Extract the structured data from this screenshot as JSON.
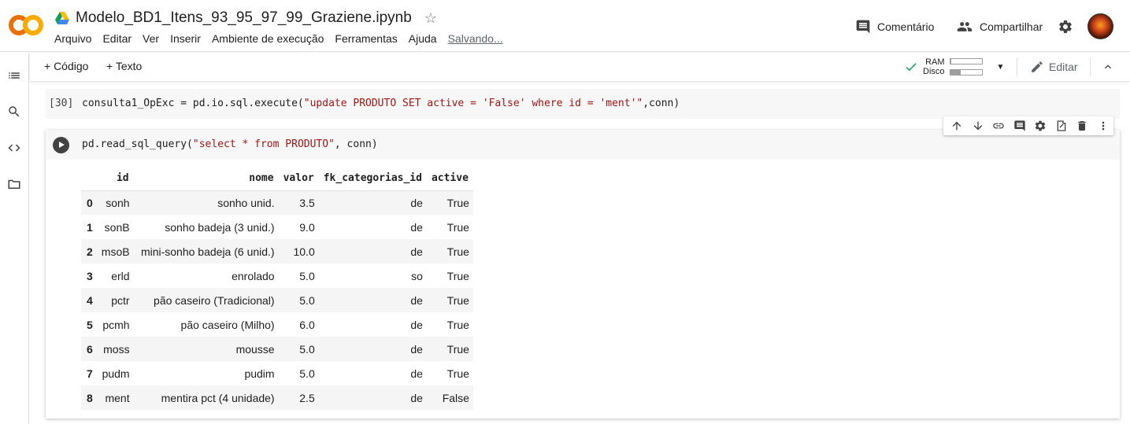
{
  "header": {
    "doc_title": "Modelo_BD1_Itens_93_95_97_99_Graziene.ipynb",
    "menu": [
      "Arquivo",
      "Editar",
      "Ver",
      "Inserir",
      "Ambiente de execução",
      "Ferramentas",
      "Ajuda"
    ],
    "saving_status": "Salvando...",
    "comment_label": "Comentário",
    "share_label": "Compartilhar"
  },
  "toolbar": {
    "add_code": "+ Código",
    "add_text": "+ Texto",
    "ram_label": "RAM",
    "disk_label": "Disco",
    "ram_usage": 0.02,
    "disk_usage": 0.34,
    "edit_label": "Editar"
  },
  "cells": {
    "cell1": {
      "exec_count": "[30]",
      "code_prefix": "consulta1_OpExc = pd.io.sql.execute(",
      "code_string": "\"update PRODUTO SET active = 'False' where id = 'ment'\"",
      "code_suffix": ",conn)"
    },
    "cell2": {
      "code_prefix": "pd.read_sql_query(",
      "code_string": "\"select * from PRODUTO\"",
      "code_suffix": ", conn)"
    }
  },
  "dataframe": {
    "columns": [
      "id",
      "nome",
      "valor",
      "fk_categorias_id",
      "active"
    ],
    "rows": [
      {
        "idx": "0",
        "id": "sonh",
        "nome": "sonho unid.",
        "valor": "3.5",
        "fk": "de",
        "active": "True"
      },
      {
        "idx": "1",
        "id": "sonB",
        "nome": "sonho badeja (3 unid.)",
        "valor": "9.0",
        "fk": "de",
        "active": "True"
      },
      {
        "idx": "2",
        "id": "msoB",
        "nome": "mini-sonho badeja (6 unid.)",
        "valor": "10.0",
        "fk": "de",
        "active": "True"
      },
      {
        "idx": "3",
        "id": "erld",
        "nome": "enrolado",
        "valor": "5.0",
        "fk": "so",
        "active": "True"
      },
      {
        "idx": "4",
        "id": "pctr",
        "nome": "pão caseiro (Tradicional)",
        "valor": "5.0",
        "fk": "de",
        "active": "True"
      },
      {
        "idx": "5",
        "id": "pcmh",
        "nome": "pão caseiro (Milho)",
        "valor": "6.0",
        "fk": "de",
        "active": "True"
      },
      {
        "idx": "6",
        "id": "moss",
        "nome": "mousse",
        "valor": "5.0",
        "fk": "de",
        "active": "True"
      },
      {
        "idx": "7",
        "id": "pudm",
        "nome": "pudim",
        "valor": "5.0",
        "fk": "de",
        "active": "True"
      },
      {
        "idx": "8",
        "id": "ment",
        "nome": "mentira pct (4 unidade)",
        "valor": "2.5",
        "fk": "de",
        "active": "False"
      }
    ]
  },
  "colors": {
    "logo_orange": "#f9ab00",
    "logo_dark_orange": "#e8710a",
    "string_red": "#a31515",
    "check_green": "#0f9d58"
  }
}
